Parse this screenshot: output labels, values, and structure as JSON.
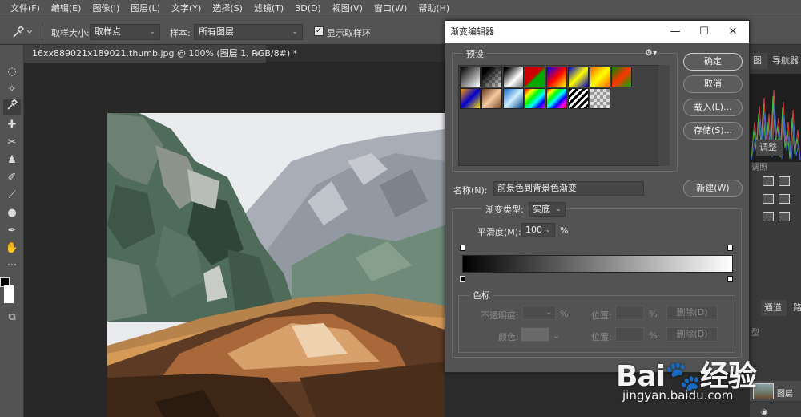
{
  "menubar": {
    "items": [
      "文件(F)",
      "编辑(E)",
      "图像(I)",
      "图层(L)",
      "文字(Y)",
      "选择(S)",
      "滤镜(T)",
      "3D(D)",
      "视图(V)",
      "窗口(W)",
      "帮助(H)"
    ]
  },
  "options": {
    "tool_icon": "eyedropper-icon",
    "sample_size_label": "取样大小:",
    "sample_size_value": "取样点",
    "sample_label": "样本:",
    "sample_value": "所有图层",
    "show_ring_label": "显示取样环",
    "show_ring_checked": true
  },
  "document": {
    "tab_title": "16xx889021x189021.thumb.jpg @ 100% (图层 1, RGB/8#) *",
    "close_glyph": "×"
  },
  "colors": {
    "foreground": "#000000",
    "background": "#ffffff"
  },
  "right_panel": {
    "histogram_tab": "图",
    "navigator_tab": "导航器",
    "adjust_tab": "调整",
    "adjust_label": "调照",
    "channels_tab": "通道",
    "channels_tab2": "路",
    "kind_label": "型",
    "layer_name": "图层"
  },
  "dialog": {
    "title": "渐变编辑器",
    "presets_label": "预设",
    "buttons": {
      "ok": "确定",
      "cancel": "取消",
      "load": "载入(L)...",
      "save": "存储(S)...",
      "new": "新建(W)"
    },
    "name_label": "名称(N):",
    "name_value": "前景色到背景色渐变",
    "gradient_type_label": "渐变类型:",
    "gradient_type_value": "实底",
    "smoothness_label": "平滑度(M):",
    "smoothness_value": "100",
    "smoothness_unit": "%",
    "stops_group_label": "色标",
    "opacity_label": "不透明度:",
    "opacity_unit": "%",
    "location_label": "位置:",
    "location_unit": "%",
    "delete_label": "删除(D)",
    "color_label": "颜色:",
    "location_label_2": "位置:",
    "location_unit_2": "%",
    "delete_label_2": "删除(D)",
    "gradient_start_color": "#000000",
    "gradient_end_color": "#ffffff"
  },
  "watermark": {
    "logo_text_a": "Bai",
    "logo_text_b": "经验",
    "url": "jingyan.baidu.com"
  }
}
